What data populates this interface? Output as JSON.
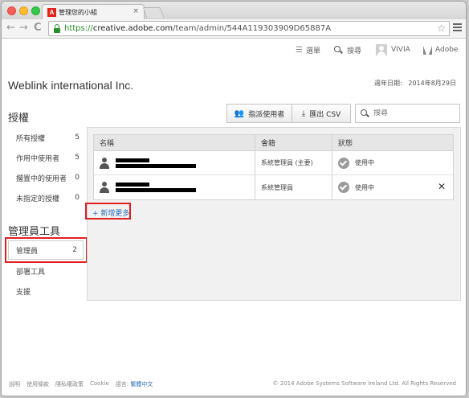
{
  "browser": {
    "tab_title": "管理您的小組",
    "tab_close": "×",
    "favicon_letter": "A",
    "back": "←",
    "forward": "→",
    "reload": "C",
    "url_scheme": "https://",
    "url_host": "creative.adobe.com",
    "url_path": "/team/admin/544A119303909D65887A",
    "star": "☆"
  },
  "topnav": {
    "menu_label": "選單",
    "menu_icon": "☰",
    "search_label": "搜尋",
    "user_name": "VIVIA",
    "adobe_label": "Adobe"
  },
  "header": {
    "company": "Weblink international Inc.",
    "renewal_label": "週年日期:",
    "renewal_date": "2014年8月29日"
  },
  "sidebar": {
    "licenses_title": "授權",
    "licenses": [
      {
        "label": "所有授權",
        "count": "5"
      },
      {
        "label": "作用中使用者",
        "count": "5"
      },
      {
        "label": "擱置中的使用者",
        "count": "0"
      },
      {
        "label": "未指定的授權",
        "count": "0"
      }
    ],
    "admin_title": "管理員工具",
    "admin_items": [
      {
        "label": "管理員",
        "count": "2"
      },
      {
        "label": "部署工具",
        "count": ""
      },
      {
        "label": "支援",
        "count": ""
      }
    ]
  },
  "actions": {
    "assign_users": "指派使用者",
    "export_csv": "匯出 CSV",
    "search_placeholder": "搜尋"
  },
  "table": {
    "headers": [
      "名稱",
      "會籍",
      "狀態"
    ],
    "rows": [
      {
        "membership": "系統管理員 (主要)",
        "status": "使用中",
        "removable": false
      },
      {
        "membership": "系統管理員",
        "status": "使用中",
        "removable": true
      }
    ],
    "remove_symbol": "✕",
    "add_more": "+ 新增更多"
  },
  "footer": {
    "links": [
      "說明",
      "使用條款",
      "隱私權政策",
      "Cookie"
    ],
    "language_label": "語言:",
    "language": "繁體中文",
    "copyright": "© 2014 Adobe Systems Software Ireland Ltd. All Rights Reserved"
  },
  "colors": {
    "highlight": "#e02020",
    "link": "#2a6fbd",
    "secure": "#2a8f2a"
  },
  "icons": [
    "lock-icon",
    "star-icon",
    "menu-icon",
    "search-icon",
    "avatar-icon",
    "adobe-logo-icon",
    "assign-users-icon",
    "export-icon",
    "person-icon",
    "check-icon",
    "remove-icon"
  ]
}
